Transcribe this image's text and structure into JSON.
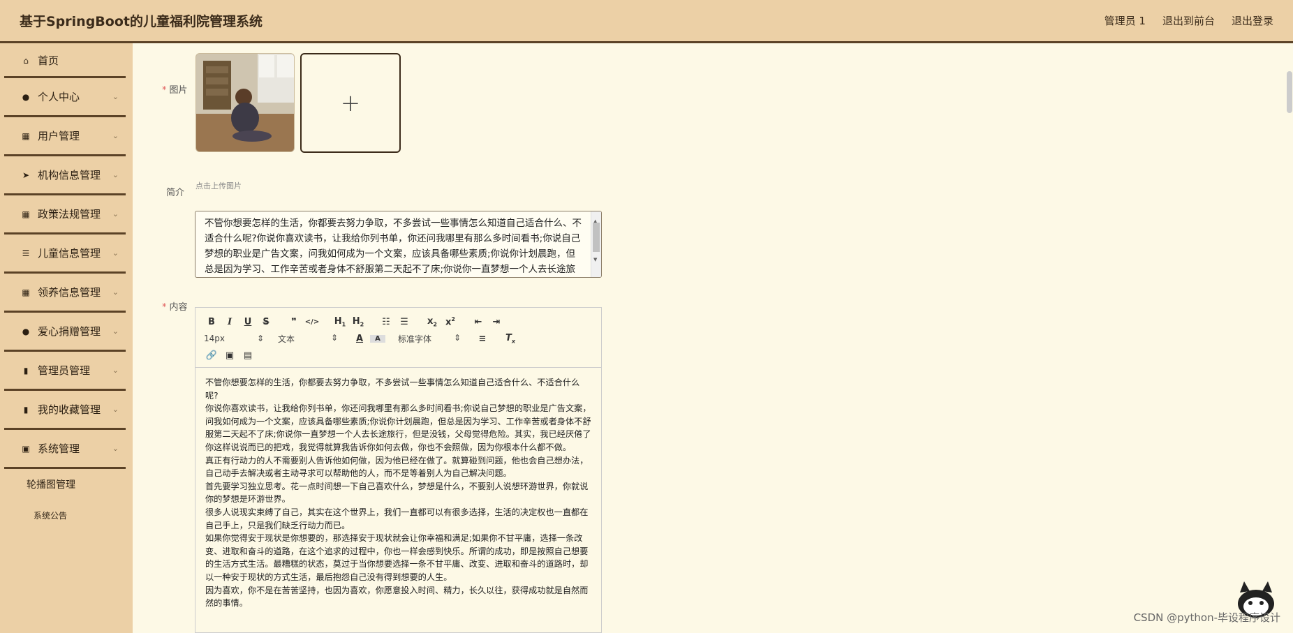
{
  "header": {
    "title": "基于SpringBoot的儿童福利院管理系统",
    "user": "管理员 1",
    "front": "退出到前台",
    "logout": "退出登录"
  },
  "sidebar": {
    "items": [
      {
        "label": "首页",
        "icon": "home-icon",
        "glyph": "⌂"
      },
      {
        "label": "个人中心",
        "icon": "user-icon",
        "glyph": "●"
      },
      {
        "label": "用户管理",
        "icon": "grid-icon",
        "glyph": "▦"
      },
      {
        "label": "机构信息管理",
        "icon": "send-icon",
        "glyph": "➤"
      },
      {
        "label": "政策法规管理",
        "icon": "grid-icon",
        "glyph": "▦"
      },
      {
        "label": "儿童信息管理",
        "icon": "list-icon",
        "glyph": "☰"
      },
      {
        "label": "领养信息管理",
        "icon": "grid-icon",
        "glyph": "▦"
      },
      {
        "label": "爱心捐赠管理",
        "icon": "person-icon",
        "glyph": "●"
      },
      {
        "label": "管理员管理",
        "icon": "chart-icon",
        "glyph": "▮"
      },
      {
        "label": "我的收藏管理",
        "icon": "bar-chart-icon",
        "glyph": "▮"
      },
      {
        "label": "系统管理",
        "icon": "clipboard-icon",
        "glyph": "▣"
      }
    ],
    "sub_items": [
      "轮播图管理",
      "系统公告"
    ]
  },
  "form": {
    "image_label": "图片",
    "upload_hint": "点击上传图片",
    "intro_label": "简介",
    "intro_text": "不管你想要怎样的生活，你都要去努力争取，不多尝试一些事情怎么知道自己适合什么、不适合什么呢?你说你喜欢读书，让我给你列书单，你还问我哪里有那么多时间看书;你说自己梦想的职业是广告文案，问我如何成为一个文案，应该具备哪些素质;你说你计划晨跑，但总是因为学习、工作辛苦或者身体不舒服第二天起不了床;你说你一直梦想一个人去长途旅行，但是没钱，父母觉得危险。",
    "content_label": "内容"
  },
  "editor": {
    "font_size": "14px",
    "text_type": "文本",
    "font_family": "标准字体",
    "paragraphs": [
      "不管你想要怎样的生活，你都要去努力争取，不多尝试一些事情怎么知道自己适合什么、不适合什么呢?",
      "你说你喜欢读书，让我给你列书单，你还问我哪里有那么多时间看书;你说自己梦想的职业是广告文案，问我如何成为一个文案，应该具备哪些素质;你说你计划晨跑，但总是因为学习、工作辛苦或者身体不舒服第二天起不了床;你说你一直梦想一个人去长途旅行，但是没钱，父母觉得危险。其实，我已经厌倦了你这样说说而已的把戏，我觉得就算我告诉你如何去做，你也不会照做，因为你根本什么都不做。",
      "真正有行动力的人不需要别人告诉他如何做，因为他已经在做了。就算碰到问题，他也会自己想办法，自己动手去解决或者主动寻求可以帮助他的人，而不是等着别人为自己解决问题。",
      "首先要学习独立思考。花一点时间想一下自己喜欢什么，梦想是什么，不要别人说想环游世界，你就说你的梦想是环游世界。",
      "很多人说现实束缚了自己，其实在这个世界上，我们一直都可以有很多选择，生活的决定权也一直都在自己手上，只是我们缺乏行动力而已。",
      "如果你觉得安于现状是你想要的，那选择安于现状就会让你幸福和满足;如果你不甘平庸，选择一条改变、进取和奋斗的道路，在这个追求的过程中，你也一样会感到快乐。所谓的成功，即是按照自己想要的生活方式生活。最糟糕的状态，莫过于当你想要选择一条不甘平庸、改变、进取和奋斗的道路时，却以一种安于现状的方式生活，最后抱怨自己没有得到想要的人生。",
      "因为喜欢，你不是在苦苦坚持，也因为喜欢，你愿意投入时间、精力，长久以往，获得成功就是自然而然的事情。"
    ]
  },
  "watermark": "CSDN @python-毕设程序设计"
}
